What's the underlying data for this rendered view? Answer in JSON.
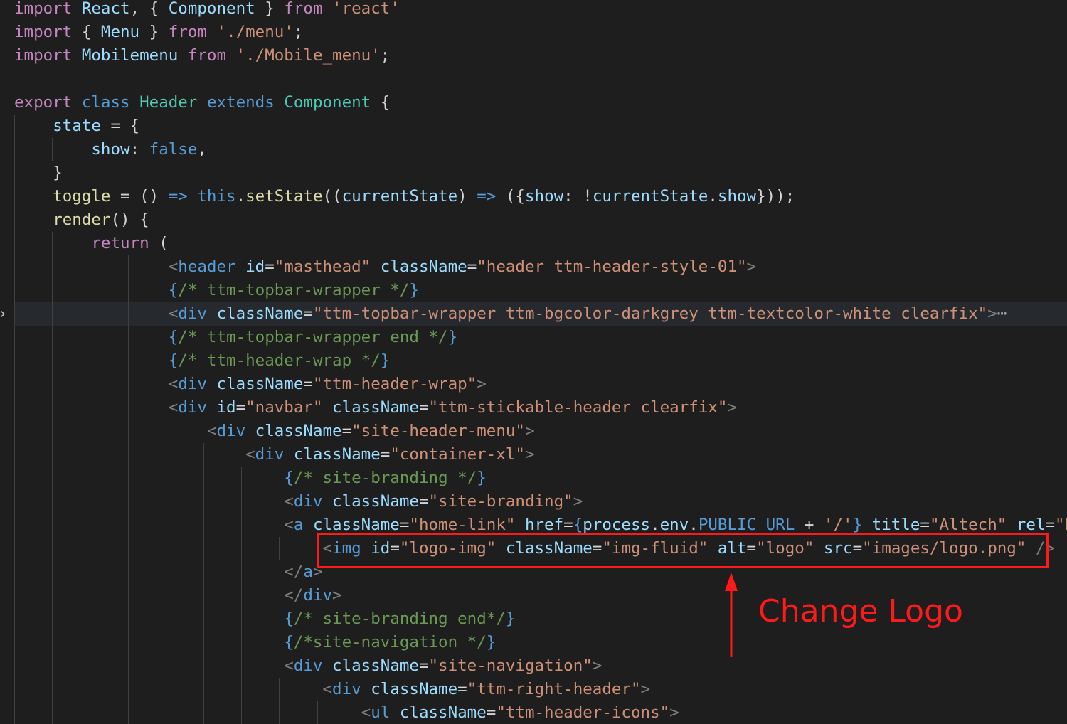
{
  "editor": {
    "lines": [
      [
        [
          "t-ctl",
          "import"
        ],
        [
          "t-pl",
          " "
        ],
        [
          "t-pr",
          "React"
        ],
        [
          "t-pl",
          ", { "
        ],
        [
          "t-pr",
          "Component"
        ],
        [
          "t-pl",
          " } "
        ],
        [
          "t-ctl",
          "from"
        ],
        [
          "t-pl",
          " "
        ],
        [
          "t-str",
          "'react'"
        ]
      ],
      [
        [
          "t-ctl",
          "import"
        ],
        [
          "t-pl",
          " { "
        ],
        [
          "t-pr",
          "Menu"
        ],
        [
          "t-pl",
          " } "
        ],
        [
          "t-ctl",
          "from"
        ],
        [
          "t-pl",
          " "
        ],
        [
          "t-str",
          "'./menu'"
        ],
        [
          "t-pl",
          ";"
        ]
      ],
      [
        [
          "t-ctl",
          "import"
        ],
        [
          "t-pl",
          " "
        ],
        [
          "t-pr",
          "Mobilemenu"
        ],
        [
          "t-pl",
          " "
        ],
        [
          "t-ctl",
          "from"
        ],
        [
          "t-pl",
          " "
        ],
        [
          "t-str",
          "'./Mobile_menu'"
        ],
        [
          "t-pl",
          ";"
        ]
      ],
      [],
      [
        [
          "t-ctl",
          "export"
        ],
        [
          "t-pl",
          " "
        ],
        [
          "t-kw",
          "class"
        ],
        [
          "t-pl",
          " "
        ],
        [
          "t-ty",
          "Header"
        ],
        [
          "t-pl",
          " "
        ],
        [
          "t-kw",
          "extends"
        ],
        [
          "t-pl",
          " "
        ],
        [
          "t-ty",
          "Component"
        ],
        [
          "t-pl",
          " {"
        ]
      ],
      [
        [
          "t-pl",
          "    "
        ],
        [
          "t-pr",
          "state"
        ],
        [
          "t-pl",
          " = {"
        ]
      ],
      [
        [
          "t-pl",
          "        "
        ],
        [
          "t-pr",
          "show"
        ],
        [
          "t-pl",
          ": "
        ],
        [
          "t-kw",
          "false"
        ],
        [
          "t-pl",
          ","
        ]
      ],
      [
        [
          "t-pl",
          "    }"
        ]
      ],
      [
        [
          "t-pl",
          "    "
        ],
        [
          "t-fn",
          "toggle"
        ],
        [
          "t-pl",
          " = () "
        ],
        [
          "t-kw",
          "=>"
        ],
        [
          "t-pl",
          " "
        ],
        [
          "t-kw",
          "this"
        ],
        [
          "t-pl",
          "."
        ],
        [
          "t-fn",
          "setState"
        ],
        [
          "t-pl",
          "(("
        ],
        [
          "t-pr",
          "currentState"
        ],
        [
          "t-pl",
          ") "
        ],
        [
          "t-kw",
          "=>"
        ],
        [
          "t-pl",
          " ({"
        ],
        [
          "t-pr",
          "show"
        ],
        [
          "t-pl",
          ": !"
        ],
        [
          "t-pr",
          "currentState"
        ],
        [
          "t-pl",
          "."
        ],
        [
          "t-pr",
          "show"
        ],
        [
          "t-pl",
          "}));"
        ]
      ],
      [
        [
          "t-pl",
          "    "
        ],
        [
          "t-fn",
          "render"
        ],
        [
          "t-pl",
          "() {"
        ]
      ],
      [
        [
          "t-pl",
          "        "
        ],
        [
          "t-ctl",
          "return"
        ],
        [
          "t-pl",
          " ("
        ]
      ],
      [
        [
          "t-pl",
          "                "
        ],
        [
          "t-br",
          "<"
        ],
        [
          "t-tag",
          "header"
        ],
        [
          "t-pl",
          " "
        ],
        [
          "t-pr",
          "id"
        ],
        [
          "t-pl",
          "="
        ],
        [
          "t-str",
          "\"masthead\""
        ],
        [
          "t-pl",
          " "
        ],
        [
          "t-pr",
          "className"
        ],
        [
          "t-pl",
          "="
        ],
        [
          "t-str",
          "\"header ttm-header-style-01\""
        ],
        [
          "t-br",
          ">"
        ]
      ],
      [
        [
          "t-pl",
          "                "
        ],
        [
          "t-kw",
          "{"
        ],
        [
          "t-cmt",
          "/* ttm-topbar-wrapper */"
        ],
        [
          "t-kw",
          "}"
        ]
      ],
      [
        [
          "t-pl",
          "                "
        ],
        [
          "t-br",
          "<"
        ],
        [
          "t-tag",
          "div"
        ],
        [
          "t-pl",
          " "
        ],
        [
          "t-pr",
          "className"
        ],
        [
          "t-pl",
          "="
        ],
        [
          "t-str",
          "\"ttm-topbar-wrapper ttm-bgcolor-darkgrey ttm-textcolor-white clearfix\""
        ],
        [
          "t-br",
          ">"
        ],
        [
          "t-fold",
          "⋯"
        ]
      ],
      [
        [
          "t-pl",
          "                "
        ],
        [
          "t-kw",
          "{"
        ],
        [
          "t-cmt",
          "/* ttm-topbar-wrapper end */"
        ],
        [
          "t-kw",
          "}"
        ]
      ],
      [
        [
          "t-pl",
          "                "
        ],
        [
          "t-kw",
          "{"
        ],
        [
          "t-cmt",
          "/* ttm-header-wrap */"
        ],
        [
          "t-kw",
          "}"
        ]
      ],
      [
        [
          "t-pl",
          "                "
        ],
        [
          "t-br",
          "<"
        ],
        [
          "t-tag",
          "div"
        ],
        [
          "t-pl",
          " "
        ],
        [
          "t-pr",
          "className"
        ],
        [
          "t-pl",
          "="
        ],
        [
          "t-str",
          "\"ttm-header-wrap\""
        ],
        [
          "t-br",
          ">"
        ]
      ],
      [
        [
          "t-pl",
          "                "
        ],
        [
          "t-br",
          "<"
        ],
        [
          "t-tag",
          "div"
        ],
        [
          "t-pl",
          " "
        ],
        [
          "t-pr",
          "id"
        ],
        [
          "t-pl",
          "="
        ],
        [
          "t-str",
          "\"navbar\""
        ],
        [
          "t-pl",
          " "
        ],
        [
          "t-pr",
          "className"
        ],
        [
          "t-pl",
          "="
        ],
        [
          "t-str",
          "\"ttm-stickable-header clearfix\""
        ],
        [
          "t-br",
          ">"
        ]
      ],
      [
        [
          "t-pl",
          "                    "
        ],
        [
          "t-br",
          "<"
        ],
        [
          "t-tag",
          "div"
        ],
        [
          "t-pl",
          " "
        ],
        [
          "t-pr",
          "className"
        ],
        [
          "t-pl",
          "="
        ],
        [
          "t-str",
          "\"site-header-menu\""
        ],
        [
          "t-br",
          ">"
        ]
      ],
      [
        [
          "t-pl",
          "                        "
        ],
        [
          "t-br",
          "<"
        ],
        [
          "t-tag",
          "div"
        ],
        [
          "t-pl",
          " "
        ],
        [
          "t-pr",
          "className"
        ],
        [
          "t-pl",
          "="
        ],
        [
          "t-str",
          "\"container-xl\""
        ],
        [
          "t-br",
          ">"
        ]
      ],
      [
        [
          "t-pl",
          "                            "
        ],
        [
          "t-kw",
          "{"
        ],
        [
          "t-cmt",
          "/* site-branding */"
        ],
        [
          "t-kw",
          "}"
        ]
      ],
      [
        [
          "t-pl",
          "                            "
        ],
        [
          "t-br",
          "<"
        ],
        [
          "t-tag",
          "div"
        ],
        [
          "t-pl",
          " "
        ],
        [
          "t-pr",
          "className"
        ],
        [
          "t-pl",
          "="
        ],
        [
          "t-str",
          "\"site-branding\""
        ],
        [
          "t-br",
          ">"
        ]
      ],
      [
        [
          "t-pl",
          "                            "
        ],
        [
          "t-br",
          "<"
        ],
        [
          "t-tag",
          "a"
        ],
        [
          "t-pl",
          " "
        ],
        [
          "t-pr",
          "className"
        ],
        [
          "t-pl",
          "="
        ],
        [
          "t-str",
          "\"home-link\""
        ],
        [
          "t-pl",
          " "
        ],
        [
          "t-pr",
          "href"
        ],
        [
          "t-pl",
          "="
        ],
        [
          "t-kw",
          "{"
        ],
        [
          "t-pr",
          "process"
        ],
        [
          "t-pl",
          "."
        ],
        [
          "t-pr",
          "env"
        ],
        [
          "t-pl",
          "."
        ],
        [
          "t-kw",
          "PUBLIC_URL"
        ],
        [
          "t-pl",
          " + "
        ],
        [
          "t-str",
          "'/'"
        ],
        [
          "t-kw",
          "}"
        ],
        [
          "t-pl",
          " "
        ],
        [
          "t-pr",
          "title"
        ],
        [
          "t-pl",
          "="
        ],
        [
          "t-str",
          "\"Altech\""
        ],
        [
          "t-pl",
          " "
        ],
        [
          "t-pr",
          "rel"
        ],
        [
          "t-pl",
          "="
        ],
        [
          "t-str",
          "\"ho"
        ]
      ],
      [
        [
          "t-pl",
          "                                "
        ],
        [
          "t-br",
          "<"
        ],
        [
          "t-tag",
          "img"
        ],
        [
          "t-pl",
          " "
        ],
        [
          "t-pr",
          "id"
        ],
        [
          "t-pl",
          "="
        ],
        [
          "t-str",
          "\"logo-img\""
        ],
        [
          "t-pl",
          " "
        ],
        [
          "t-pr",
          "className"
        ],
        [
          "t-pl",
          "="
        ],
        [
          "t-str",
          "\"img-fluid\""
        ],
        [
          "t-pl",
          " "
        ],
        [
          "t-pr",
          "alt"
        ],
        [
          "t-pl",
          "="
        ],
        [
          "t-str",
          "\"logo\""
        ],
        [
          "t-pl",
          " "
        ],
        [
          "t-pr",
          "src"
        ],
        [
          "t-pl",
          "="
        ],
        [
          "t-str",
          "\"images/logo.png\""
        ],
        [
          "t-pl",
          " "
        ],
        [
          "t-br",
          "/>"
        ]
      ],
      [
        [
          "t-pl",
          "                            "
        ],
        [
          "t-br",
          "</"
        ],
        [
          "t-tag",
          "a"
        ],
        [
          "t-br",
          ">"
        ]
      ],
      [
        [
          "t-pl",
          "                            "
        ],
        [
          "t-br",
          "</"
        ],
        [
          "t-tag",
          "div"
        ],
        [
          "t-br",
          ">"
        ]
      ],
      [
        [
          "t-pl",
          "                            "
        ],
        [
          "t-kw",
          "{"
        ],
        [
          "t-cmt",
          "/* site-branding end*/"
        ],
        [
          "t-kw",
          "}"
        ]
      ],
      [
        [
          "t-pl",
          "                            "
        ],
        [
          "t-kw",
          "{"
        ],
        [
          "t-cmt",
          "/*site-navigation */"
        ],
        [
          "t-kw",
          "}"
        ]
      ],
      [
        [
          "t-pl",
          "                            "
        ],
        [
          "t-br",
          "<"
        ],
        [
          "t-tag",
          "div"
        ],
        [
          "t-pl",
          " "
        ],
        [
          "t-pr",
          "className"
        ],
        [
          "t-pl",
          "="
        ],
        [
          "t-str",
          "\"site-navigation\""
        ],
        [
          "t-br",
          ">"
        ]
      ],
      [
        [
          "t-pl",
          "                                "
        ],
        [
          "t-br",
          "<"
        ],
        [
          "t-tag",
          "div"
        ],
        [
          "t-pl",
          " "
        ],
        [
          "t-pr",
          "className"
        ],
        [
          "t-pl",
          "="
        ],
        [
          "t-str",
          "\"ttm-right-header\""
        ],
        [
          "t-br",
          ">"
        ]
      ],
      [
        [
          "t-pl",
          "                                    "
        ],
        [
          "t-br",
          "<"
        ],
        [
          "t-tag",
          "ul"
        ],
        [
          "t-pl",
          " "
        ],
        [
          "t-pr",
          "className"
        ],
        [
          "t-pl",
          "="
        ],
        [
          "t-str",
          "\"ttm-header-icons\""
        ],
        [
          "t-br",
          ">"
        ]
      ]
    ],
    "highlighted_line_index": 13,
    "folded_chevron": "›"
  },
  "annotation": {
    "label": "Change Logo",
    "color": "#ff1a1a"
  }
}
